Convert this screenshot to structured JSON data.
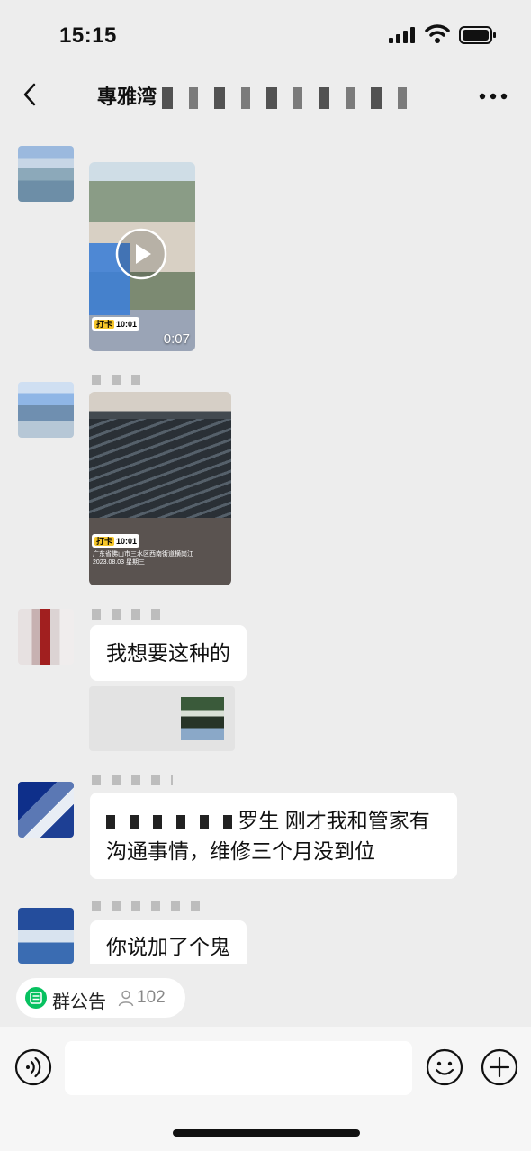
{
  "status_bar": {
    "time": "15:15",
    "icons": [
      "signal-icon",
      "wifi-icon",
      "battery-icon"
    ]
  },
  "header": {
    "title_visible": "專雅湾",
    "icons": [
      "back-icon",
      "more-icon"
    ]
  },
  "messages": [
    {
      "type": "video",
      "duration": "0:07",
      "punch_label": "打卡",
      "punch_time": "10:01"
    },
    {
      "type": "image",
      "punch_label": "打卡",
      "punch_time": "10:01",
      "location": "广东省佛山市三水区西南街道横岗江",
      "date": "2023.08.03 星期三"
    },
    {
      "type": "text",
      "text": "我想要这种的"
    },
    {
      "type": "link_card"
    },
    {
      "type": "text",
      "line1": "罗生 刚才我和管家有",
      "line2": "沟通事情，维修三个月没到位"
    },
    {
      "type": "text",
      "text": "你说加了个鬼"
    }
  ],
  "group_notice": {
    "label": "群公告",
    "member_count": "102"
  },
  "colors": {
    "background": "#ededed",
    "bubble": "#ffffff",
    "notice_green": "#07c160"
  }
}
